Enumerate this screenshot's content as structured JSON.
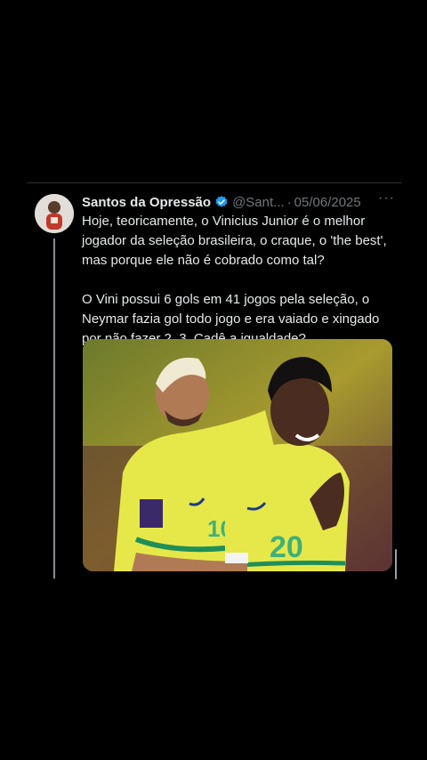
{
  "tweet": {
    "author_name": "Santos da Opressão",
    "handle": "@Sant...",
    "separator": "·",
    "date": "05/06/2025",
    "more_label": "···",
    "paragraphs": [
      "Hoje, teoricamente, o Vinicius Junior é o melhor jogador da seleção brasileira, o craque, o 'the best', mas porque ele não é cobrado como tal?",
      "O Vini possui 6 gols em 41 jogos pela seleção, o Neymar fazia gol todo jogo e era vaiado e xingado por não fazer 2, 3. Cadê a igualdade?"
    ],
    "verified_color": "#1d9bf0",
    "media": {
      "left_jersey_number": "10",
      "right_jersey_number": "20"
    }
  },
  "colors": {
    "background": "#000000",
    "text": "#e7e9ea",
    "muted": "#71767b",
    "jersey_yellow": "#e6e84a",
    "jersey_green": "#1f8f5a"
  }
}
